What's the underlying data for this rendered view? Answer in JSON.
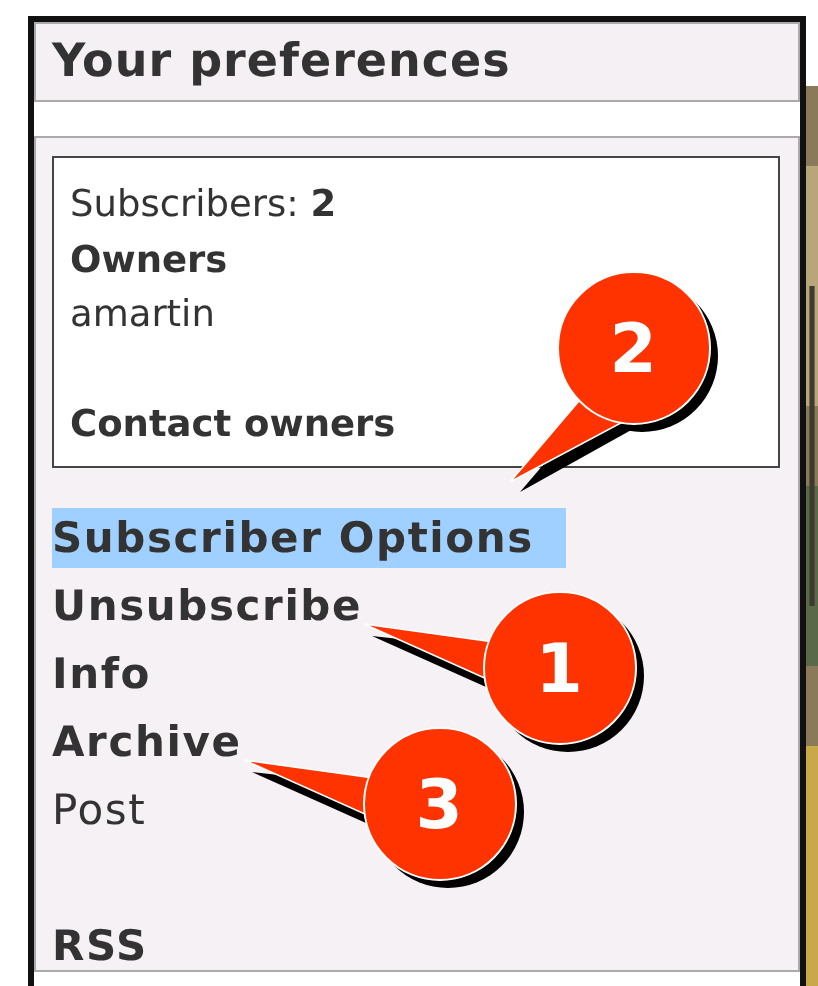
{
  "header": {
    "title": "Your preferences"
  },
  "summary": {
    "subscribers_label": "Subscribers:",
    "subscribers_count": "2",
    "owners_heading": "Owners",
    "owners": [
      "amartin"
    ],
    "contact_link": "Contact owners"
  },
  "links": [
    {
      "label": "Subscriber Options",
      "bold": true,
      "selected": true,
      "callout": {
        "number": "2",
        "kind": "below"
      }
    },
    {
      "label": "Unsubscribe",
      "bold": true,
      "selected": false,
      "callout": {
        "number": "1",
        "kind": "right"
      }
    },
    {
      "label": "Info",
      "bold": true,
      "selected": false
    },
    {
      "label": "Archive",
      "bold": true,
      "selected": false,
      "callout": {
        "number": "3",
        "kind": "right"
      }
    },
    {
      "label": "Post",
      "bold": false,
      "selected": false
    }
  ],
  "feed_link": "RSS"
}
